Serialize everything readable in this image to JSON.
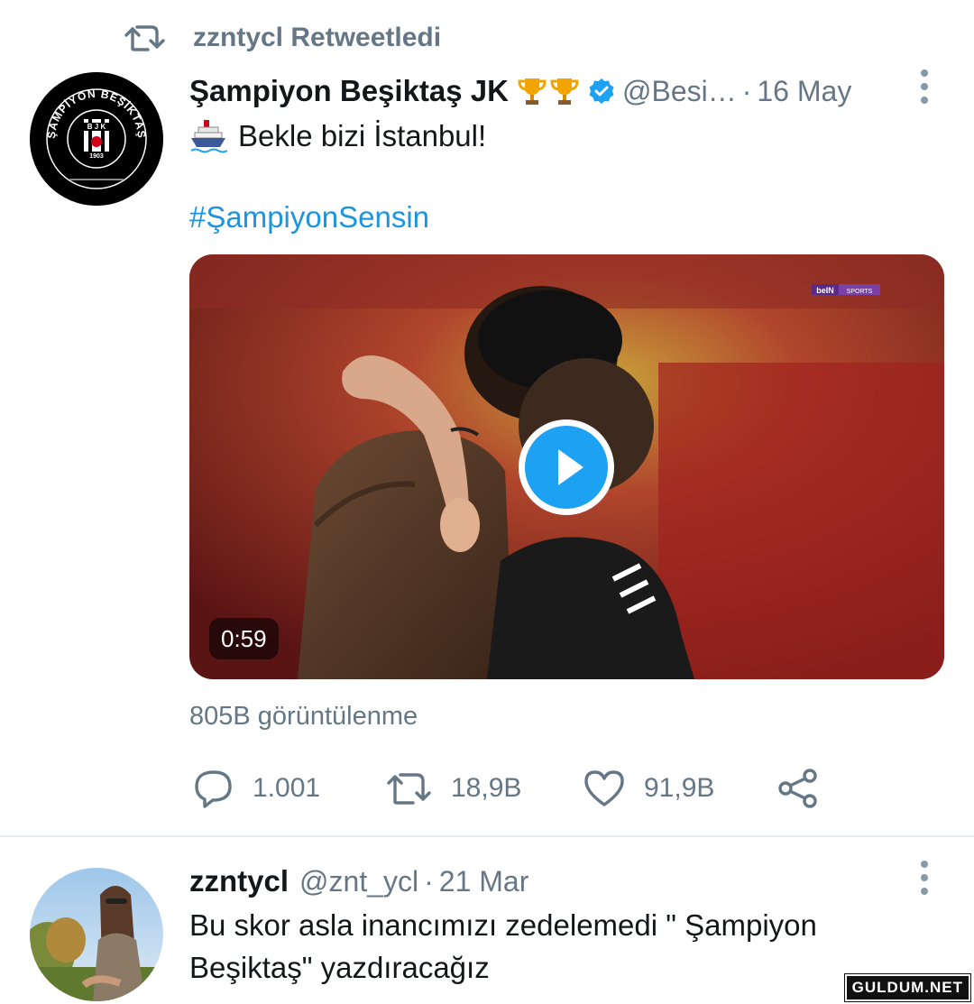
{
  "retweet": {
    "label": "zzntycl Retweetledi"
  },
  "tweet1": {
    "display_name": "Şampiyon Beşiktaş JK",
    "handle": "@Besi…",
    "separator": "·",
    "date": "16 May",
    "text": "Bekle bizi İstanbul!",
    "hashtag": "#ŞampiyonSensin",
    "video": {
      "duration": "0:59",
      "broadcaster": "beIN SPORTS"
    },
    "views": "805B görüntülenme",
    "actions": {
      "replies": "1.001",
      "retweets": "18,9B",
      "likes": "91,9B"
    },
    "avatar": {
      "ring_text": "ŞAMPİYON BEŞİKTAŞ",
      "crest_text": "BJK",
      "year": "1903"
    }
  },
  "tweet2": {
    "display_name": "zzntycl",
    "handle": "@znt_ycl",
    "separator": "·",
    "date": "21 Mar",
    "text_line1": "Bu skor asla inancımızı zedelemedi \" Şampiyon",
    "text_line2": "Beşiktaş\" yazdıracağız"
  },
  "watermark": "GULDUM.NET",
  "colors": {
    "accent": "#1da1f2",
    "hashtag": "#1b95e0",
    "muted": "#657786",
    "trophy": "#f4a400"
  }
}
